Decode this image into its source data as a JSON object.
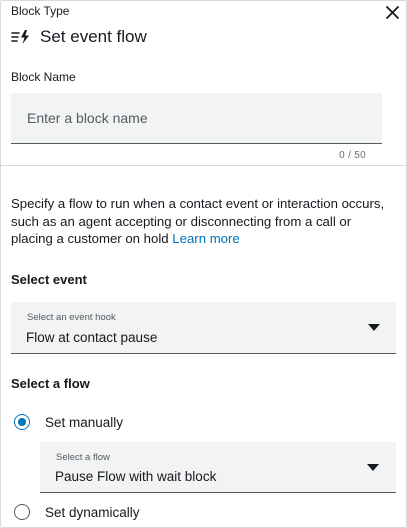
{
  "header": {
    "block_type_label": "Block Type",
    "title": "Set event flow",
    "title_icon": "flow-bolt-icon",
    "close_icon": "close-icon"
  },
  "block_name": {
    "label": "Block Name",
    "value": "",
    "placeholder": "Enter a block name",
    "char_count": "0 / 50"
  },
  "description": {
    "text": "Specify a flow to run when a contact event or interaction occurs, such as an agent accepting or disconnecting from a call or placing a customer on hold",
    "link_text": "Learn more"
  },
  "select_event": {
    "heading": "Select event",
    "field_label": "Select an event hook",
    "selected_value": "Flow at contact pause"
  },
  "select_flow": {
    "heading": "Select a flow",
    "options": [
      {
        "label": "Set manually",
        "checked": true
      },
      {
        "label": "Set dynamically",
        "checked": false
      }
    ],
    "flow_field_label": "Select a flow",
    "flow_selected_value": "Pause Flow with wait block"
  },
  "colors": {
    "accent": "#0073bb",
    "field_bg": "#f2f3f3",
    "text": "#16191f",
    "muted": "#545b64"
  }
}
